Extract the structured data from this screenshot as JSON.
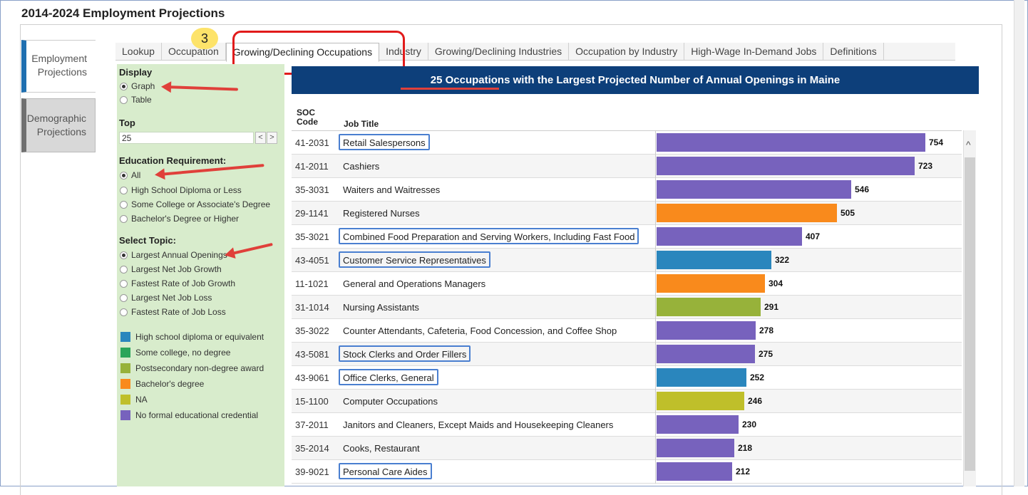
{
  "page_title": "2014-2024 Employment Projections",
  "side_tabs": [
    "Employment Projections",
    "Demographic Projections"
  ],
  "tabs": [
    "Lookup",
    "Occupation",
    "Growing/Declining Occupations",
    "Industry",
    "Growing/Declining Industries",
    "Occupation by Industry",
    "High-Wage In-Demand Jobs",
    "Definitions"
  ],
  "active_tab": "Growing/Declining Occupations",
  "callout_number": "3",
  "filters": {
    "display_label": "Display",
    "display_options": [
      "Graph",
      "Table"
    ],
    "display_selected": "Graph",
    "top_label": "Top",
    "top_value": "25",
    "prev_label": "<",
    "next_label": ">",
    "education_label": "Education Requirement:",
    "education_options": [
      "All",
      "High School Diploma or Less",
      "Some College or Associate's Degree",
      "Bachelor's Degree or Higher"
    ],
    "education_selected": "All",
    "topic_label": "Select Topic:",
    "topic_options": [
      "Largest Annual Openings",
      "Largest Net Job Growth",
      "Fastest Rate of Job Growth",
      "Largest Net Job Loss",
      "Fastest Rate of Job Loss"
    ],
    "topic_selected": "Largest Annual Openings"
  },
  "legend": [
    {
      "label": "High school diploma or equivalent",
      "color": "#2a86bd"
    },
    {
      "label": "Some college, no degree",
      "color": "#2aa55a"
    },
    {
      "label": "Postsecondary non-degree award",
      "color": "#97b23a"
    },
    {
      "label": "Bachelor's degree",
      "color": "#f98a1c"
    },
    {
      "label": "NA",
      "color": "#bfbf2a"
    },
    {
      "label": "No formal educational credential",
      "color": "#7762bd"
    }
  ],
  "banner_title": "25 Occupations with the Largest Projected Number of Annual Openings in Maine",
  "columns": {
    "soc_line1": "SOC",
    "soc_line2": "Code",
    "job_title": "Job Title"
  },
  "chart_data": {
    "type": "bar",
    "title": "25 Occupations with the Largest Projected Number of Annual Openings in Maine",
    "categories": [
      "Retail Salespersons",
      "Cashiers",
      "Waiters and Waitresses",
      "Registered Nurses",
      "Combined Food Preparation and Serving Workers, Including Fast Food",
      "Customer Service Representatives",
      "General and Operations Managers",
      "Nursing Assistants",
      "Counter Attendants, Cafeteria, Food Concession, and Coffee Shop",
      "Stock Clerks and Order Fillers",
      "Office Clerks, General",
      "Computer Occupations",
      "Janitors and Cleaners, Except Maids and Housekeeping Cleaners",
      "Cooks, Restaurant",
      "Personal Care Aides"
    ],
    "values": [
      754,
      723,
      546,
      505,
      407,
      322,
      304,
      291,
      278,
      275,
      252,
      246,
      230,
      218,
      212
    ],
    "xlim": [
      0,
      800
    ]
  },
  "rows": [
    {
      "soc": "41-2031",
      "title": "Retail Salespersons",
      "value": 754,
      "color": "#7762bd",
      "highlight": true
    },
    {
      "soc": "41-2011",
      "title": "Cashiers",
      "value": 723,
      "color": "#7762bd",
      "highlight": false
    },
    {
      "soc": "35-3031",
      "title": "Waiters and Waitresses",
      "value": 546,
      "color": "#7762bd",
      "highlight": false
    },
    {
      "soc": "29-1141",
      "title": "Registered Nurses",
      "value": 505,
      "color": "#f98a1c",
      "highlight": false
    },
    {
      "soc": "35-3021",
      "title": "Combined Food Preparation and Serving Workers, Including Fast Food",
      "value": 407,
      "color": "#7762bd",
      "highlight": true
    },
    {
      "soc": "43-4051",
      "title": "Customer Service Representatives",
      "value": 322,
      "color": "#2a86bd",
      "highlight": true
    },
    {
      "soc": "11-1021",
      "title": "General and Operations Managers",
      "value": 304,
      "color": "#f98a1c",
      "highlight": false
    },
    {
      "soc": "31-1014",
      "title": "Nursing Assistants",
      "value": 291,
      "color": "#97b23a",
      "highlight": false
    },
    {
      "soc": "35-3022",
      "title": "Counter Attendants, Cafeteria, Food Concession, and Coffee Shop",
      "value": 278,
      "color": "#7762bd",
      "highlight": false
    },
    {
      "soc": "43-5081",
      "title": "Stock Clerks and Order Fillers",
      "value": 275,
      "color": "#7762bd",
      "highlight": true
    },
    {
      "soc": "43-9061",
      "title": "Office Clerks, General",
      "value": 252,
      "color": "#2a86bd",
      "highlight": true
    },
    {
      "soc": "15-1100",
      "title": "Computer Occupations",
      "value": 246,
      "color": "#bfbf2a",
      "highlight": false
    },
    {
      "soc": "37-2011",
      "title": "Janitors and Cleaners, Except Maids and Housekeeping Cleaners",
      "value": 230,
      "color": "#7762bd",
      "highlight": false
    },
    {
      "soc": "35-2014",
      "title": "Cooks, Restaurant",
      "value": 218,
      "color": "#7762bd",
      "highlight": false
    },
    {
      "soc": "39-9021",
      "title": "Personal Care Aides",
      "value": 212,
      "color": "#7762bd",
      "highlight": true
    }
  ],
  "scroll_up_label": "^"
}
